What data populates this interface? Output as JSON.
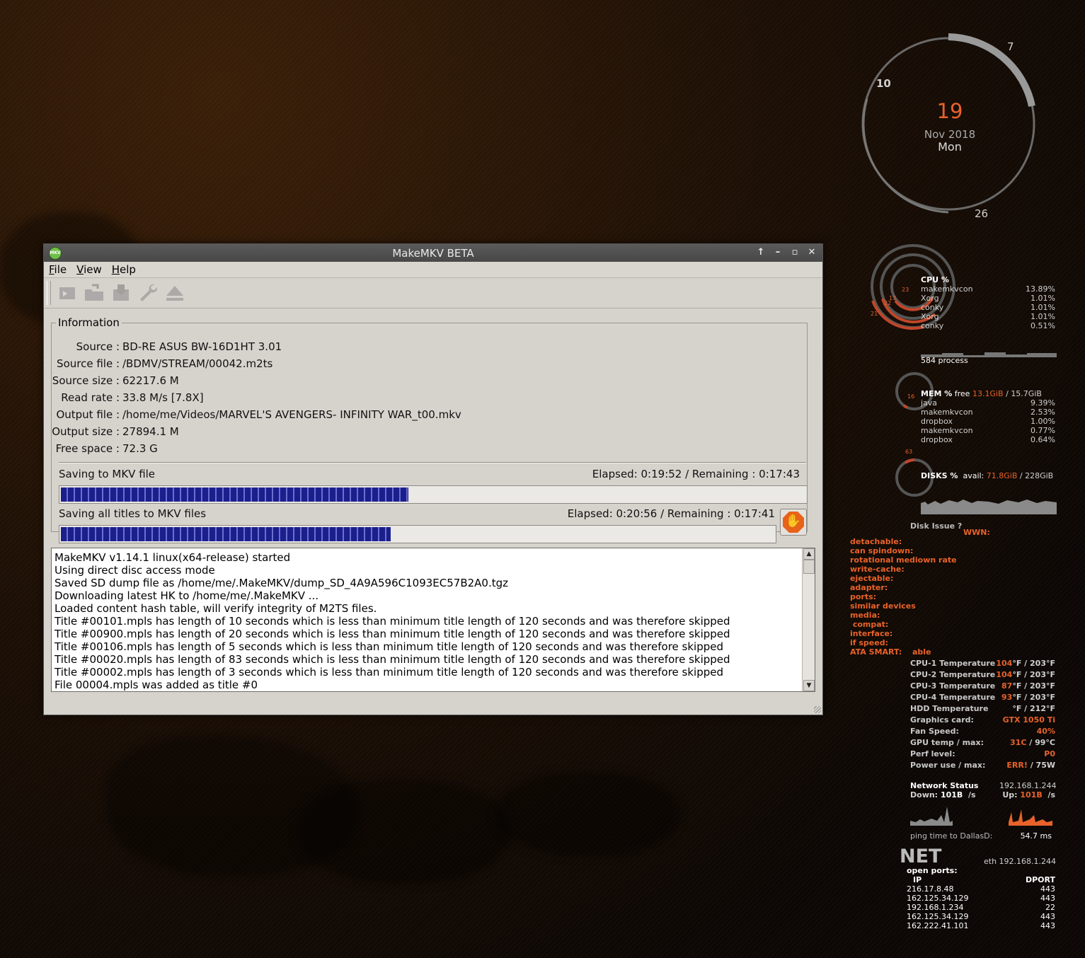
{
  "window": {
    "title": "MakeMKV BETA",
    "icon_text": "MKV",
    "menus": [
      "File",
      "View",
      "Help"
    ],
    "toolbar_icons": [
      "open-files-icon",
      "open-disc-icon",
      "backup-icon",
      "preferences-wrench-icon",
      "eject-icon"
    ]
  },
  "info": {
    "legend": "Information",
    "fields": [
      {
        "label": "Source :",
        "value": "BD-RE ASUS BW-16D1HT 3.01"
      },
      {
        "label": "Source file :",
        "value": "/BDMV/STREAM/00042.m2ts"
      },
      {
        "label": "Source size :",
        "value": "62217.6 M"
      },
      {
        "label": "Read rate :",
        "value": "33.8 M/s [7.8X]"
      },
      {
        "label": "Output file :",
        "value": "/home/me/Videos/MARVEL'S AVENGERS- INFINITY WAR_t00.mkv"
      },
      {
        "label": "Output size :",
        "value": "27894.1 M"
      },
      {
        "label": "Free space :",
        "value": "72.3 G"
      }
    ]
  },
  "progress": {
    "current": {
      "label": "Saving to MKV file",
      "time": "Elapsed: 0:19:52 / Remaining : 0:17:43",
      "fraction": 0.465
    },
    "total": {
      "label": "Saving all titles to MKV files",
      "time": "Elapsed: 0:20:56 / Remaining : 0:17:41",
      "fraction": 0.46
    }
  },
  "log": [
    "MakeMKV v1.14.1 linux(x64-release) started",
    "Using direct disc access mode",
    "Saved SD dump file as /home/me/.MakeMKV/dump_SD_4A9A596C1093EC57B2A0.tgz",
    "Downloading latest HK to /home/me/.MakeMKV ...",
    "Loaded content hash table, will verify integrity of M2TS files.",
    "Title #00101.mpls has length of 10 seconds which is less than minimum title length of 120 seconds and was therefore skipped",
    "Title #00900.mpls has length of 20 seconds which is less than minimum title length of 120 seconds and was therefore skipped",
    "Title #00106.mpls has length of 5 seconds which is less than minimum title length of 120 seconds and was therefore skipped",
    "Title #00020.mpls has length of 83 seconds which is less than minimum title length of 120 seconds and was therefore skipped",
    "Title #00002.mpls has length of 3 seconds which is less than minimum title length of 120 seconds and was therefore skipped",
    "File 00004.mpls was added as title #0"
  ],
  "conky": {
    "clock": {
      "day": "19",
      "month_year": "Nov 2018",
      "weekday": "Mon",
      "n7": "7",
      "n10": "10",
      "n26": "26"
    },
    "cpu": {
      "title": "CPU %",
      "ring_labels": [
        "23",
        "13",
        "22",
        "21"
      ],
      "procs": [
        {
          "name": "makemkvcon",
          "val": "13.89%"
        },
        {
          "name": "Xorg",
          "val": "1.01%"
        },
        {
          "name": "conky",
          "val": "1.01%"
        },
        {
          "name": "Xorg",
          "val": "1.01%"
        },
        {
          "name": "conky",
          "val": "0.51%"
        }
      ],
      "process_count": "584 process"
    },
    "mem": {
      "title": "MEM %",
      "free_label": "free",
      "free": "13.1GiB",
      "slash": "/",
      "total": "15.7GiB",
      "ring_label": "16",
      "procs": [
        {
          "name": "java",
          "val": "9.39%"
        },
        {
          "name": "makemkvcon",
          "val": "2.53%"
        },
        {
          "name": "dropbox",
          "val": "1.00%"
        },
        {
          "name": "makemkvcon",
          "val": "0.77%"
        },
        {
          "name": "dropbox",
          "val": "0.64%"
        }
      ]
    },
    "disks": {
      "title": "DISKS %",
      "avail_label": "avail:",
      "avail": "71.8GiB",
      "slash": "/",
      "total": "228GiB",
      "ring_label": "63"
    },
    "disk_issue": {
      "title": "Disk Issue ?",
      "wwn": "WWN:",
      "props": [
        "detachable:",
        "can spindown:",
        "rotational mediown rate",
        "write-cache:",
        "ejectable:",
        "adapter:",
        "ports:",
        "similar devices",
        "media:",
        " compat:",
        "interface:",
        "if speed:"
      ],
      "smart_label": "ATA SMART:",
      "smart_value": "able"
    },
    "temps": [
      {
        "label": "CPU-1 Temperature",
        "val": "104",
        "unit": "°F / 203°F"
      },
      {
        "label": "CPU-2 Temperature",
        "val": "104",
        "unit": "°F / 203°F"
      },
      {
        "label": "CPU-3 Temperature",
        "val": "87",
        "unit": "°F / 203°F"
      },
      {
        "label": "CPU-4 Temperature",
        "val": "93",
        "unit": "°F / 203°F"
      },
      {
        "label": "HDD Temperature",
        "val": "",
        "unit": "°F / 212°F"
      },
      {
        "label": "Graphics card:",
        "val": "GTX 1050 Ti",
        "unit": ""
      },
      {
        "label": "Fan Speed:",
        "val": "40%",
        "unit": ""
      },
      {
        "label": "GPU temp / max:",
        "val": "31C",
        "unit": " / 99°C"
      },
      {
        "label": "Perf level:",
        "val": "P0",
        "unit": ""
      },
      {
        "label": "Power use / max:",
        "val": "ERR!",
        "unit": " / 75W"
      }
    ],
    "network": {
      "title": "Network Status",
      "ip": "192.168.1.244",
      "down_label": "Down:",
      "down": "101B",
      "down_unit": "/s",
      "up_label": "Up:",
      "up": "101B",
      "up_unit": "/s",
      "ping_label": "ping time to DallasD:",
      "ping": "54.7 ms"
    },
    "net": {
      "title": "NET",
      "eth": "eth 192.168.1.244",
      "open_ports": "open ports:",
      "col_ip": "IP",
      "col_port": "DPORT",
      "rows": [
        {
          "ip": "216.17.8.48",
          "port": "443"
        },
        {
          "ip": "162.125.34.129",
          "port": "443"
        },
        {
          "ip": "192.168.1.234",
          "port": "22"
        },
        {
          "ip": "162.125.34.129",
          "port": "443"
        },
        {
          "ip": "162.222.41.101",
          "port": "443"
        }
      ]
    },
    "colors": {
      "accent": "#e8622a",
      "text": "#d0d0d0"
    }
  }
}
